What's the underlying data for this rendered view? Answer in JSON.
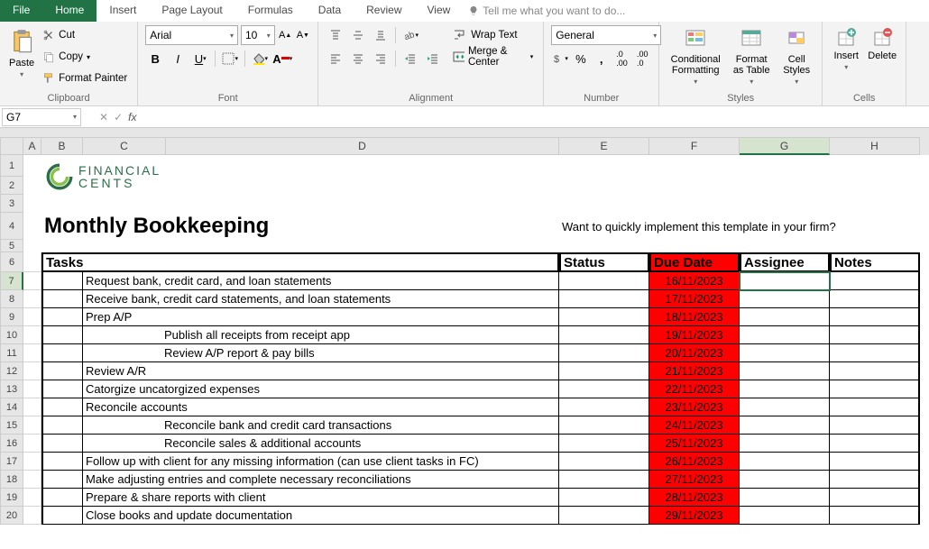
{
  "tabs": {
    "file": "File",
    "home": "Home",
    "insert": "Insert",
    "pageLayout": "Page Layout",
    "formulas": "Formulas",
    "data": "Data",
    "review": "Review",
    "view": "View",
    "tellme": "Tell me what you want to do..."
  },
  "ribbon": {
    "clipboard": {
      "paste": "Paste",
      "cut": "Cut",
      "copy": "Copy",
      "formatPainter": "Format Painter",
      "label": "Clipboard"
    },
    "font": {
      "name": "Arial",
      "size": "10",
      "label": "Font"
    },
    "alignment": {
      "wrap": "Wrap Text",
      "merge": "Merge & Center",
      "label": "Alignment"
    },
    "number": {
      "format": "General",
      "label": "Number"
    },
    "styles": {
      "cond": "Conditional Formatting",
      "fmtTable": "Format as Table",
      "cellStyles": "Cell Styles",
      "label": "Styles"
    },
    "cells": {
      "insert": "Insert",
      "delete": "Delete",
      "label": "Cells"
    }
  },
  "namebox": "G7",
  "cols": [
    "A",
    "B",
    "C",
    "D",
    "E",
    "F",
    "G",
    "H"
  ],
  "logo": {
    "l1": "FINANCIAL",
    "l2": "CENTS"
  },
  "title": "Monthly Bookkeeping",
  "blurb": "Want to quickly implement this template in your firm?",
  "headers": {
    "tasks": "Tasks",
    "status": "Status",
    "due": "Due Date",
    "assignee": "Assignee",
    "notes": "Notes"
  },
  "rows": [
    {
      "n": 7,
      "task": "Request bank, credit card, and loan statements",
      "due": "16/11/2023",
      "indent": false
    },
    {
      "n": 8,
      "task": "Receive bank, credit card statements, and loan statements",
      "due": "17/11/2023",
      "indent": false
    },
    {
      "n": 9,
      "task": "Prep A/P",
      "due": "18/11/2023",
      "indent": false
    },
    {
      "n": 10,
      "task": "Publish all receipts from receipt app",
      "due": "19/11/2023",
      "indent": true
    },
    {
      "n": 11,
      "task": "Review A/P report & pay bills",
      "due": "20/11/2023",
      "indent": true
    },
    {
      "n": 12,
      "task": "Review A/R",
      "due": "21/11/2023",
      "indent": false
    },
    {
      "n": 13,
      "task": "Catorgize uncatorgized expenses",
      "due": "22/11/2023",
      "indent": false
    },
    {
      "n": 14,
      "task": "Reconcile accounts",
      "due": "23/11/2023",
      "indent": false
    },
    {
      "n": 15,
      "task": "Reconcile bank and credit card transactions",
      "due": "24/11/2023",
      "indent": true
    },
    {
      "n": 16,
      "task": "Reconcile sales & additional accounts",
      "due": "25/11/2023",
      "indent": true
    },
    {
      "n": 17,
      "task": "Follow up with client for any missing information (can use client tasks in FC)",
      "due": "26/11/2023",
      "indent": false
    },
    {
      "n": 18,
      "task": "Make adjusting entries and complete necessary reconciliations",
      "due": "27/11/2023",
      "indent": false
    },
    {
      "n": 19,
      "task": "Prepare & share reports with client",
      "due": "28/11/2023",
      "indent": false
    },
    {
      "n": 20,
      "task": "Close books and update documentation",
      "due": "29/11/2023",
      "indent": false
    }
  ],
  "selected_cell": "G7"
}
